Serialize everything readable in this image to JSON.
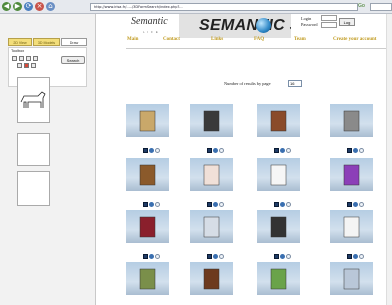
{
  "browser": {
    "url": "http://www.irisa.fr/...../3DFormSearch/index.php?...",
    "go_label": "Go"
  },
  "sidebar": {
    "tabs": [
      "2D View",
      "3D Models",
      "Draw"
    ],
    "toolbox_label": "Toolbox",
    "search_button": "Search"
  },
  "header": {
    "logo_script": "Semantic",
    "logo_sub": "L I F E",
    "banner_text": "SEMANTIC 3D",
    "login_label": "Login",
    "password_label": "Password",
    "login_button": "Log"
  },
  "nav": [
    "Main",
    "Contact",
    "Links",
    "FAQ",
    "Team",
    "Create your account"
  ],
  "results": {
    "per_page_label": "Number of results by page",
    "per_page_value": "16",
    "items": [
      {
        "name": "knight-figure",
        "color": "#c9a86a"
      },
      {
        "name": "iron-gate",
        "color": "#3a3a3a"
      },
      {
        "name": "wooden-chair",
        "color": "#8a4b2a"
      },
      {
        "name": "shelf-frame",
        "color": "#8a8a8a"
      },
      {
        "name": "horse",
        "color": "#8b5a2b"
      },
      {
        "name": "cake",
        "color": "#f0e0d8"
      },
      {
        "name": "white-table",
        "color": "#f6f6f6"
      },
      {
        "name": "purple-spiral",
        "color": "#8c3fb8"
      },
      {
        "name": "red-gallows",
        "color": "#8a1f2c"
      },
      {
        "name": "glass-chair",
        "color": "#d6dde6"
      },
      {
        "name": "dark-table",
        "color": "#333333"
      },
      {
        "name": "white-plane",
        "color": "#f4f4f4"
      },
      {
        "name": "dinosaur",
        "color": "#7a8f4a"
      },
      {
        "name": "brown-table",
        "color": "#6d3a1e"
      },
      {
        "name": "green-animal",
        "color": "#6aa34a"
      },
      {
        "name": "glass-shelf",
        "color": "#b9c7d8"
      }
    ]
  }
}
